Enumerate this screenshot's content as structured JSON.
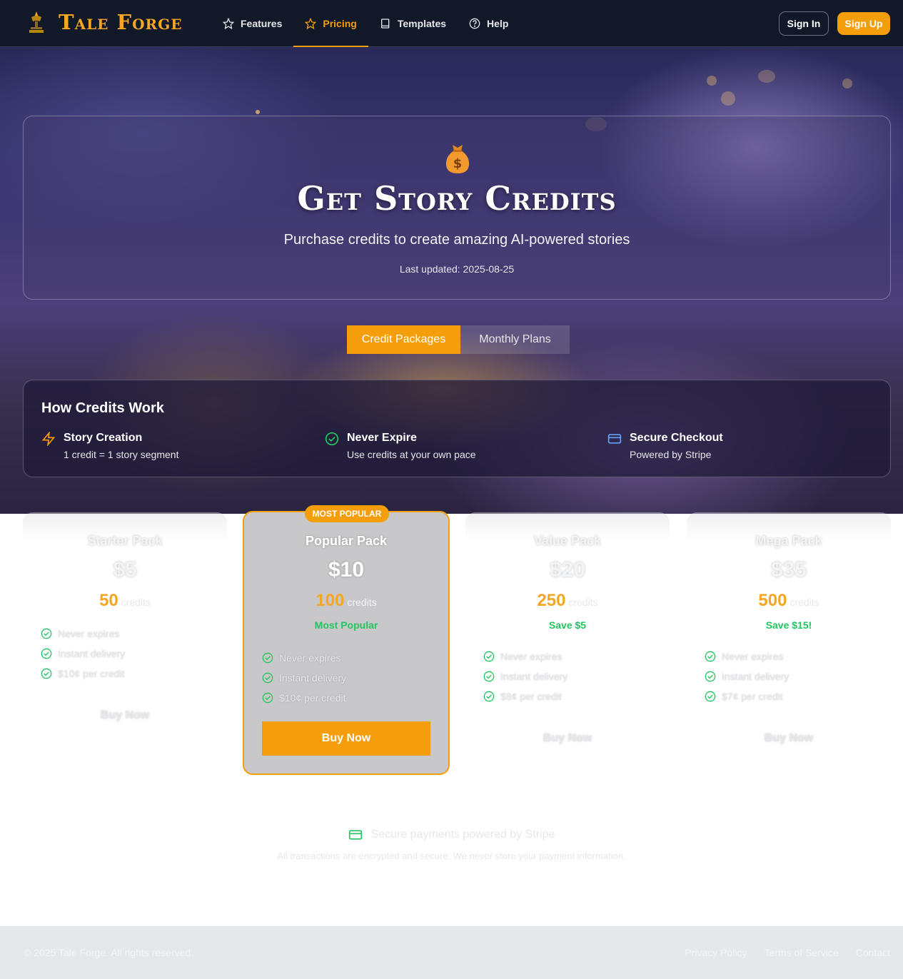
{
  "nav": {
    "brand": "Tale Forge",
    "links": [
      {
        "label": "Features",
        "icon": "star-icon"
      },
      {
        "label": "Pricing",
        "icon": "star-icon",
        "active": true
      },
      {
        "label": "Templates",
        "icon": "book-icon"
      },
      {
        "label": "Help",
        "icon": "help-circle-icon"
      }
    ],
    "sign_in": "Sign In",
    "sign_up": "Sign Up"
  },
  "hero": {
    "icon": "money-bag-icon",
    "title": "Get Story Credits",
    "subtitle": "Purchase credits to create amazing AI-powered stories",
    "updated": "Last updated: 2025-08-25"
  },
  "tabs": [
    {
      "label": "Credit Packages",
      "active": true
    },
    {
      "label": "Monthly Plans",
      "active": false
    }
  ],
  "how": {
    "title": "How Credits Work",
    "items": [
      {
        "title": "Story Creation",
        "desc": "1 credit = 1 story segment",
        "icon": "zap-icon"
      },
      {
        "title": "Never Expire",
        "desc": "Use credits at your own pace",
        "icon": "check-circle-icon"
      },
      {
        "title": "Secure Checkout",
        "desc": "Powered by Stripe",
        "icon": "credit-card-icon"
      }
    ]
  },
  "packages": [
    {
      "name": "Starter Pack",
      "price": "$5",
      "credits": "50",
      "credits_unit": "credits",
      "save": "",
      "features": [
        "Never expires",
        "Instant delivery",
        "$10¢ per credit"
      ],
      "buy": "Buy Now"
    },
    {
      "name": "Popular Pack",
      "price": "$10",
      "credits": "100",
      "credits_unit": "credits",
      "save": "Most Popular",
      "badge": "MOST POPULAR",
      "features": [
        "Never expires",
        "Instant delivery",
        "$10¢ per credit"
      ],
      "buy": "Buy Now"
    },
    {
      "name": "Value Pack",
      "price": "$20",
      "credits": "250",
      "credits_unit": "credits",
      "save": "Save $5",
      "features": [
        "Never expires",
        "Instant delivery",
        "$8¢ per credit"
      ],
      "buy": "Buy Now"
    },
    {
      "name": "Mega Pack",
      "price": "$35",
      "credits": "500",
      "credits_unit": "credits",
      "save": "Save $15!",
      "features": [
        "Never expires",
        "Instant delivery",
        "$7¢ per credit"
      ],
      "buy": "Buy Now"
    }
  ],
  "secure": {
    "title": "Secure payments powered by Stripe",
    "note": "All transactions are encrypted and secure. We never store your payment information."
  },
  "footer": {
    "copyright": "© 2025 Tale Forge. All rights reserved.",
    "links": [
      "Privacy Policy",
      "Terms of Service",
      "Contact"
    ]
  },
  "colors": {
    "accent": "#f59e0b",
    "brand": "#f5a623",
    "success": "#22c55e",
    "nav_bg": "#111827"
  }
}
